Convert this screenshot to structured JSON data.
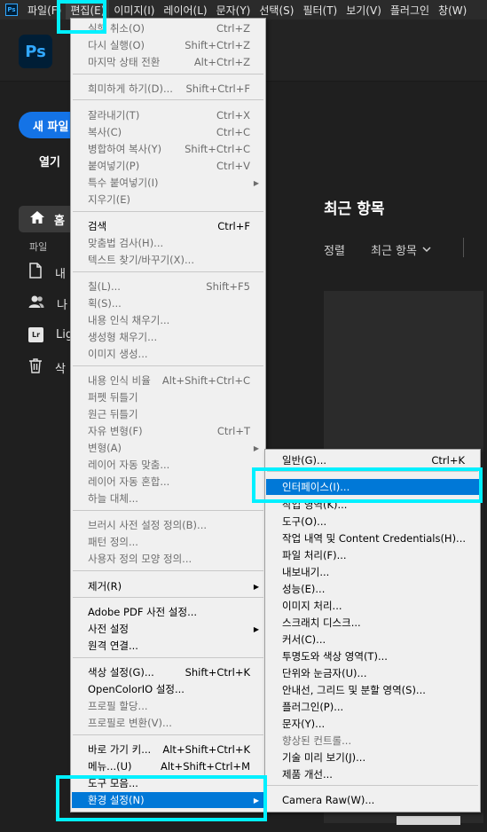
{
  "menubar": {
    "app_mini": "Ps",
    "items": [
      "파일(F)",
      "편집(E)",
      "이미지(I)",
      "레이어(L)",
      "문자(Y)",
      "선택(S)",
      "필터(T)",
      "보기(V)",
      "플러그인",
      "창(W)"
    ]
  },
  "app": {
    "logo": "Ps"
  },
  "left": {
    "new_file": "새 파일",
    "open": "열기",
    "home": "홈",
    "files_label": "파일",
    "items": [
      "내",
      "나",
      "Lig",
      "삭"
    ],
    "lr_icon": "Lr"
  },
  "main": {
    "title": "최근 항목",
    "sort": "정렬",
    "filter": "최근 항목"
  },
  "edit_menu": {
    "items": [
      {
        "label": "실행 취소(O)",
        "shortcut": "Ctrl+Z",
        "disabled": true
      },
      {
        "label": "다시 실행(O)",
        "shortcut": "Shift+Ctrl+Z",
        "disabled": true
      },
      {
        "label": "마지막 상태 전환",
        "shortcut": "Alt+Ctrl+Z",
        "disabled": true
      },
      {
        "label": "희미하게 하기(D)...",
        "shortcut": "Shift+Ctrl+F",
        "disabled": true
      },
      {
        "label": "잘라내기(T)",
        "shortcut": "Ctrl+X",
        "disabled": true
      },
      {
        "label": "복사(C)",
        "shortcut": "Ctrl+C",
        "disabled": true
      },
      {
        "label": "병합하여 복사(Y)",
        "shortcut": "Shift+Ctrl+C",
        "disabled": true
      },
      {
        "label": "붙여넣기(P)",
        "shortcut": "Ctrl+V",
        "disabled": true
      },
      {
        "label": "특수 붙여넣기(I)",
        "shortcut": "",
        "disabled": true,
        "submenu": true
      },
      {
        "label": "지우기(E)",
        "shortcut": "",
        "disabled": true
      },
      {
        "label": "검색",
        "shortcut": "Ctrl+F",
        "disabled": false
      },
      {
        "label": "맞춤법 검사(H)...",
        "shortcut": "",
        "disabled": true
      },
      {
        "label": "텍스트 찾기/바꾸기(X)...",
        "shortcut": "",
        "disabled": true
      },
      {
        "label": "칠(L)...",
        "shortcut": "Shift+F5",
        "disabled": true
      },
      {
        "label": "획(S)...",
        "shortcut": "",
        "disabled": true
      },
      {
        "label": "내용 인식 채우기...",
        "shortcut": "",
        "disabled": true
      },
      {
        "label": "생성형 채우기...",
        "shortcut": "",
        "disabled": true
      },
      {
        "label": "이미지 생성...",
        "shortcut": "",
        "disabled": true
      },
      {
        "label": "내용 인식 비율",
        "shortcut": "Alt+Shift+Ctrl+C",
        "disabled": true
      },
      {
        "label": "퍼펫 뒤틀기",
        "shortcut": "",
        "disabled": true
      },
      {
        "label": "원근 뒤틀기",
        "shortcut": "",
        "disabled": true
      },
      {
        "label": "자유 변형(F)",
        "shortcut": "Ctrl+T",
        "disabled": true
      },
      {
        "label": "변형(A)",
        "shortcut": "",
        "disabled": true,
        "submenu": true
      },
      {
        "label": "레이어 자동 맞춤...",
        "shortcut": "",
        "disabled": true
      },
      {
        "label": "레이어 자동 혼합...",
        "shortcut": "",
        "disabled": true
      },
      {
        "label": "하늘 대체...",
        "shortcut": "",
        "disabled": true
      },
      {
        "label": "브러시 사전 설정 정의(B)...",
        "shortcut": "",
        "disabled": true
      },
      {
        "label": "패턴 정의...",
        "shortcut": "",
        "disabled": true
      },
      {
        "label": "사용자 정의 모양 정의...",
        "shortcut": "",
        "disabled": true
      },
      {
        "label": "제거(R)",
        "shortcut": "",
        "disabled": false,
        "submenu": true
      },
      {
        "label": "Adobe PDF 사전 설정...",
        "shortcut": "",
        "disabled": false
      },
      {
        "label": "사전 설정",
        "shortcut": "",
        "disabled": false,
        "submenu": true
      },
      {
        "label": "원격 연결...",
        "shortcut": "",
        "disabled": false
      },
      {
        "label": "색상 설정(G)...",
        "shortcut": "Shift+Ctrl+K",
        "disabled": false
      },
      {
        "label": "OpenColorIO 설정...",
        "shortcut": "",
        "disabled": false
      },
      {
        "label": "프로필 할당...",
        "shortcut": "",
        "disabled": true
      },
      {
        "label": "프로필로 변환(V)...",
        "shortcut": "",
        "disabled": true
      },
      {
        "label": "바로 가기 키...",
        "shortcut": "Alt+Shift+Ctrl+K",
        "disabled": false
      },
      {
        "label": "메뉴...(U)",
        "shortcut": "Alt+Shift+Ctrl+M",
        "disabled": false
      },
      {
        "label": "도구 모음...",
        "shortcut": "",
        "disabled": false
      },
      {
        "label": "환경 설정(N)",
        "shortcut": "",
        "disabled": false,
        "submenu": true,
        "selected": true
      }
    ]
  },
  "prefs_menu": {
    "items": [
      {
        "label": "일반(G)...",
        "shortcut": "Ctrl+K"
      },
      {
        "label": "인터페이스(I)...",
        "shortcut": "",
        "selected": true
      },
      {
        "label": "작업 영역(K)...",
        "shortcut": ""
      },
      {
        "label": "도구(O)...",
        "shortcut": ""
      },
      {
        "label": "작업 내역 및 Content Credentials(H)...",
        "shortcut": ""
      },
      {
        "label": "파일 처리(F)...",
        "shortcut": ""
      },
      {
        "label": "내보내기...",
        "shortcut": ""
      },
      {
        "label": "성능(E)...",
        "shortcut": ""
      },
      {
        "label": "이미지 처리...",
        "shortcut": ""
      },
      {
        "label": "스크래치 디스크...",
        "shortcut": ""
      },
      {
        "label": "커서(C)...",
        "shortcut": ""
      },
      {
        "label": "투명도와 색상 영역(T)...",
        "shortcut": ""
      },
      {
        "label": "단위와 눈금자(U)...",
        "shortcut": ""
      },
      {
        "label": "안내선, 그리드 및 분할 영역(S)...",
        "shortcut": ""
      },
      {
        "label": "플러그인(P)...",
        "shortcut": ""
      },
      {
        "label": "문자(Y)...",
        "shortcut": ""
      },
      {
        "label": "향상된 컨트롤...",
        "shortcut": "",
        "disabled": true
      },
      {
        "label": "기술 미리 보기(J)...",
        "shortcut": ""
      },
      {
        "label": "제품 개선...",
        "shortcut": ""
      },
      {
        "label": "Camera Raw(W)...",
        "shortcut": ""
      }
    ]
  },
  "colors": {
    "highlight": "#00f0ff",
    "selection": "#0078d7",
    "accent": "#1473e6"
  }
}
